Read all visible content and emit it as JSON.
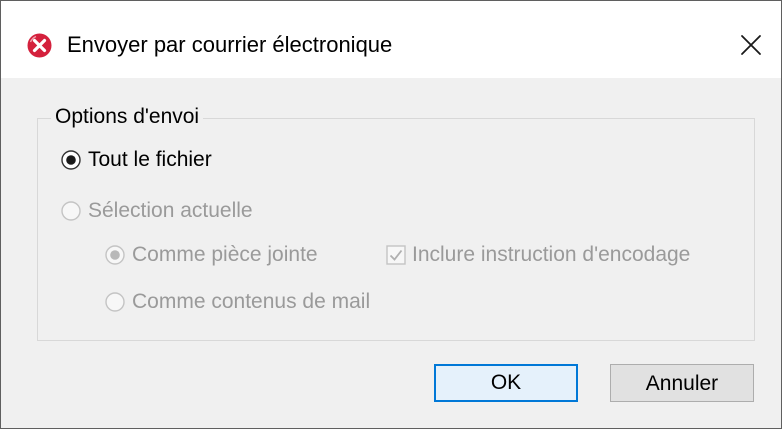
{
  "window": {
    "title": "Envoyer par courrier électronique",
    "close_symbol": "✕"
  },
  "group": {
    "title": "Options d'envoi"
  },
  "options": {
    "whole_file": {
      "label": "Tout le fichier",
      "checked": true,
      "enabled": true
    },
    "current_selection": {
      "label": "Sélection actuelle",
      "checked": false,
      "enabled": false
    },
    "as_attachment": {
      "label": "Comme pièce jointe",
      "checked": true,
      "enabled": false
    },
    "as_mail_content": {
      "label": "Comme contenus de mail",
      "checked": false,
      "enabled": false
    },
    "include_encoding": {
      "label": "Inclure instruction d'encodage",
      "checked": true,
      "enabled": false
    }
  },
  "buttons": {
    "ok": "OK",
    "cancel": "Annuler"
  },
  "colors": {
    "accent": "#0078d7",
    "icon_red": "#d4213d",
    "disabled_text": "#9a9a9a",
    "dialog_bg": "#f0f0f0"
  },
  "icons": {
    "app": "red-circle-x-icon",
    "close": "close-icon"
  }
}
